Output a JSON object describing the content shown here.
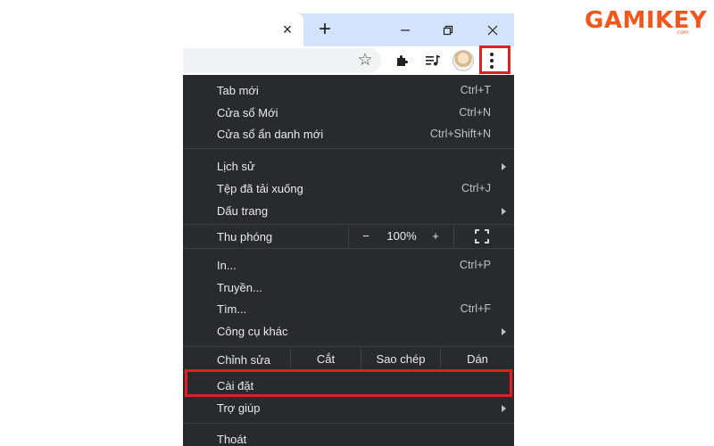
{
  "logo": {
    "text": "GAMIKEY",
    "domain": ".com"
  },
  "colors": {
    "accent_red": "#e01e26",
    "menu_bg": "#292a2d",
    "logo_orange": "#f3571d",
    "tabstrip": "#d3e3fd"
  },
  "tabbar": {
    "close_icon": "×",
    "new_tab_icon": "+"
  },
  "toolbar": {
    "star_icon": "☆"
  },
  "menu": {
    "group1": [
      {
        "label": "Tab mới",
        "shortcut": "Ctrl+T"
      },
      {
        "label": "Cửa sổ Mới",
        "shortcut": "Ctrl+N"
      },
      {
        "label": "Cửa sổ ẩn danh mới",
        "shortcut": "Ctrl+Shift+N"
      }
    ],
    "group2": [
      {
        "label": "Lịch sử"
      },
      {
        "label": "Tệp đã tải xuống",
        "shortcut": "Ctrl+J"
      },
      {
        "label": "Dấu trang"
      }
    ],
    "zoom": {
      "label": "Thu phóng",
      "minus": "−",
      "value": "100%",
      "plus": "+"
    },
    "group3": [
      {
        "label": "In...",
        "shortcut": "Ctrl+P"
      },
      {
        "label": "Truyền..."
      },
      {
        "label": "Tìm...",
        "shortcut": "Ctrl+F"
      },
      {
        "label": "Công cụ khác"
      }
    ],
    "edit": {
      "label": "Chỉnh sửa",
      "cut": "Cắt",
      "copy": "Sao chép",
      "paste": "Dán"
    },
    "group4": [
      {
        "label": "Cài đặt"
      },
      {
        "label": "Trợ giúp"
      }
    ],
    "exit": {
      "label": "Thoát"
    }
  }
}
